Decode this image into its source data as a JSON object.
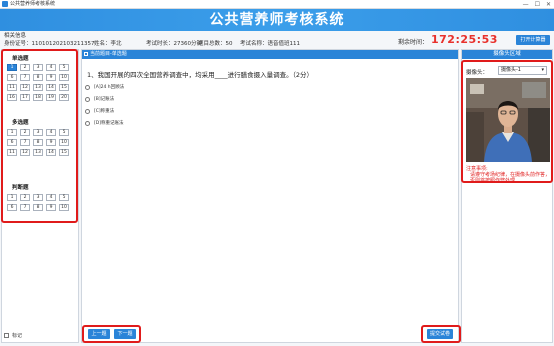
{
  "window": {
    "app_title": "公共营养师考核系统",
    "controls": [
      "—",
      "☐",
      "✕"
    ]
  },
  "header": {
    "title": "公共营养师考核系统"
  },
  "info": {
    "section_label": "相关信息",
    "id_number": "身份证号：110101202103211357",
    "name": "姓名：李北",
    "duration": "考试时长：27360分钟",
    "total": "题目总数：50",
    "exam_name": "考试名称：语音值班111",
    "timer_label": "剩余时间：",
    "timer": "172:25:53",
    "calc_button": "打开计算器"
  },
  "question_nav": {
    "groups": [
      {
        "title": "单选题",
        "items": [
          "1",
          "2",
          "3",
          "4",
          "5",
          "6",
          "7",
          "8",
          "9",
          "10",
          "11",
          "12",
          "13",
          "14",
          "15",
          "16",
          "17",
          "18",
          "19",
          "20"
        ],
        "active": "1"
      },
      {
        "title": "多选题",
        "items": [
          "1",
          "2",
          "3",
          "4",
          "5",
          "6",
          "7",
          "8",
          "9",
          "10",
          "11",
          "12",
          "13",
          "14",
          "15"
        ]
      },
      {
        "title": "判断题",
        "items": [
          "1",
          "2",
          "3",
          "4",
          "5",
          "6",
          "7",
          "8",
          "9",
          "10"
        ]
      }
    ],
    "mark_label": "标记"
  },
  "question": {
    "header": "当前题目-单选题",
    "text": "1、我国开展的四次全国营养调查中，均采用____进行膳食摄入量调查。（2分）",
    "options": [
      "[A]24 h回顾法",
      "[B]记账法",
      "[C]称重法",
      "[D]称重记账法"
    ],
    "prev_button": "上一题",
    "next_button": "下一题",
    "submit_button": "提交试卷"
  },
  "camera": {
    "header": "摄像头区域",
    "label": "摄像头：",
    "selected": "摄像头-1",
    "notice_title": "注意事项:",
    "notice_body": "请遵守考场纪律，在摄像头前作答，否则将按照作弊处理"
  },
  "colors": {
    "accent": "#2a84d8",
    "highlight": "#e01b1b",
    "timer": "#e8312c"
  }
}
